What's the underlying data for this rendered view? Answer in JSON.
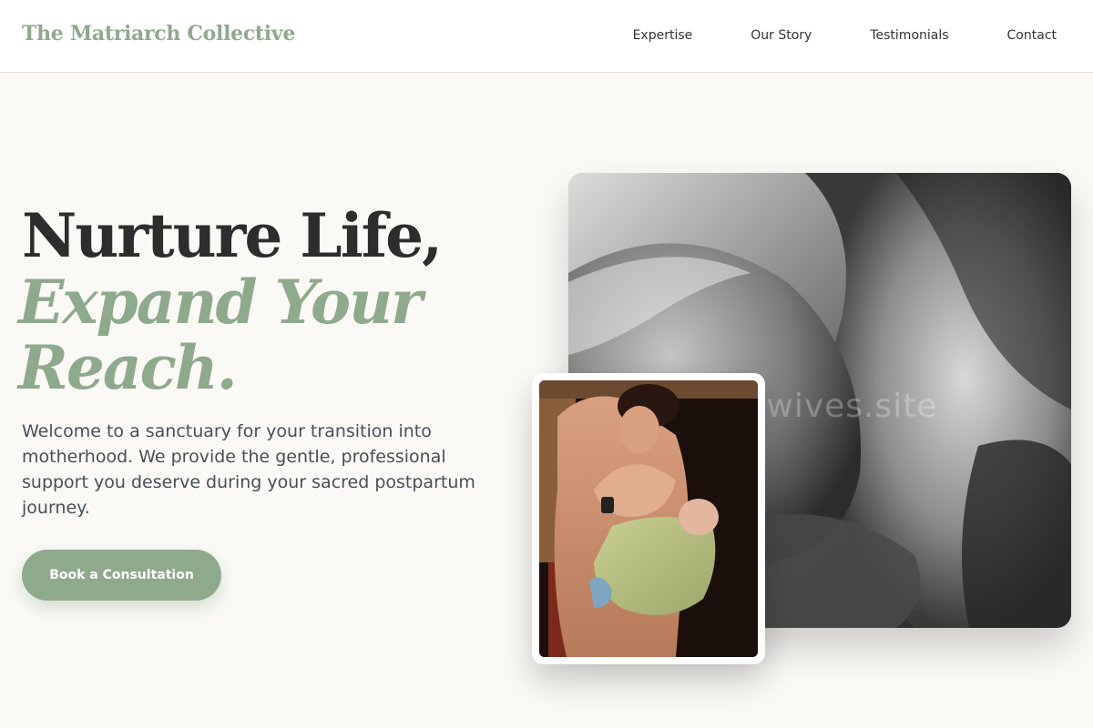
{
  "header": {
    "brand": "The Matriarch Collective",
    "nav": [
      {
        "label": "Expertise"
      },
      {
        "label": "Our Story"
      },
      {
        "label": "Testimonials"
      },
      {
        "label": "Contact"
      }
    ]
  },
  "hero": {
    "title_line1": "Nurture Life,",
    "title_line2": "Expand Your Reach.",
    "intro": "Welcome to a sanctuary for your transition into motherhood. We provide the gentle, professional support you deserve during your sacred postpartum journey.",
    "cta_label": "Book a Consultation"
  },
  "media": {
    "main_watermark": "midwives.site"
  },
  "colors": {
    "accent": "#8fa98d",
    "heading": "#2d2d2d",
    "body_text": "#4a4e57",
    "background": "#faf9f6"
  }
}
